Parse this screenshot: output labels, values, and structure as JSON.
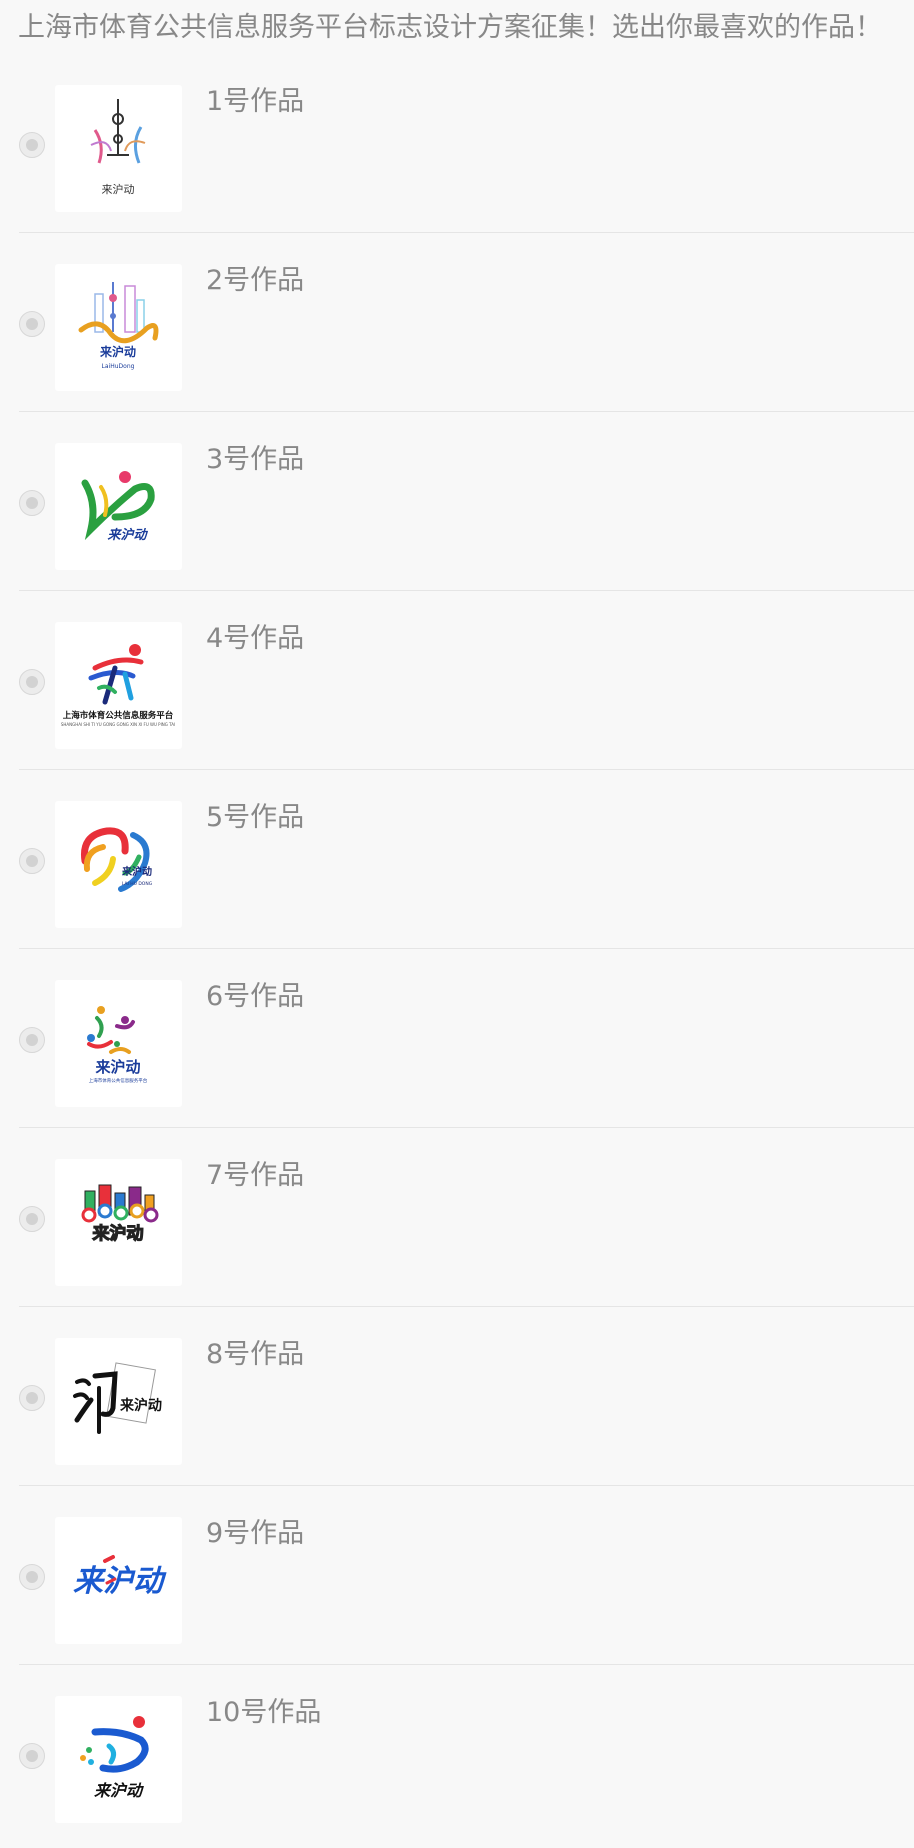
{
  "question": {
    "title": "上海市体育公共信息服务平台标志设计方案征集！选出你最喜欢的作品！"
  },
  "options": [
    {
      "label": "1号作品",
      "logo": "logo-1-pearl-tower-dancers",
      "text": "来沪动"
    },
    {
      "label": "2号作品",
      "logo": "logo-2-skyline-dragon",
      "text": "来沪动"
    },
    {
      "label": "3号作品",
      "logo": "logo-3-green-runner",
      "text": "来沪动"
    },
    {
      "label": "4号作品",
      "logo": "logo-4-runner-platform",
      "text": "上海市体育公共信息服务平台"
    },
    {
      "label": "5号作品",
      "logo": "logo-5-rainbow-swirl",
      "text": "来沪动"
    },
    {
      "label": "6号作品",
      "logo": "logo-6-sports-figures",
      "text": "来沪动"
    },
    {
      "label": "7号作品",
      "logo": "logo-7-colorful-city",
      "text": "来沪动"
    },
    {
      "label": "8号作品",
      "logo": "logo-8-brush-calligraphy",
      "text": "来沪动"
    },
    {
      "label": "9号作品",
      "logo": "logo-9-blue-red-text",
      "text": "来沪动"
    },
    {
      "label": "10号作品",
      "logo": "logo-10-blue-runner",
      "text": "来沪动"
    }
  ],
  "colors": {
    "background": "#f8f8f8",
    "text_muted": "#888888",
    "divider": "#e5e5e5"
  }
}
